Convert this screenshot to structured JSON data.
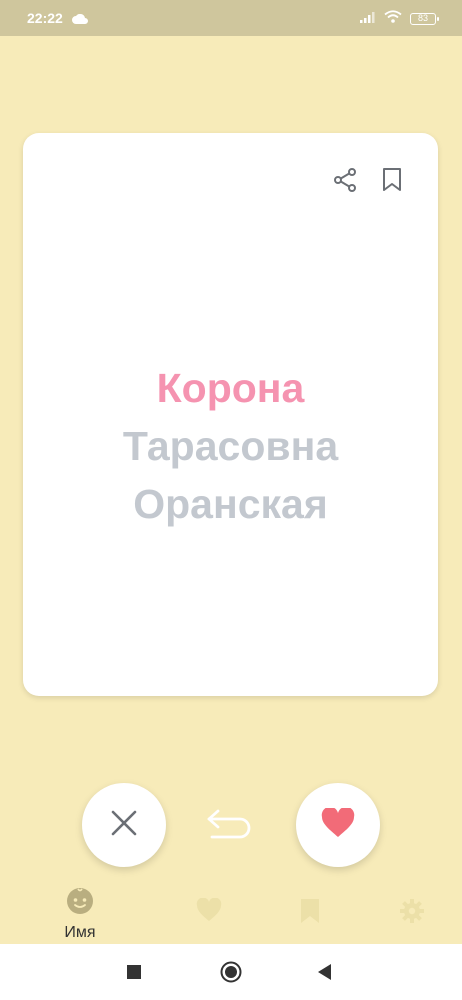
{
  "status_bar": {
    "time": "22:22",
    "battery": "83",
    "cloud_icon": "cloud-icon",
    "signal_icon": "signal-icon",
    "wifi_icon": "wifi-icon"
  },
  "card": {
    "first_name": "Корона",
    "patronymic": "Тарасовна",
    "surname": "Оранская",
    "share_icon": "share-icon",
    "bookmark_icon": "bookmark-icon"
  },
  "actions": {
    "dislike_icon": "close-icon",
    "undo_icon": "undo-icon",
    "like_icon": "heart-icon"
  },
  "bottom_nav": {
    "items": [
      {
        "icon": "baby-face-icon",
        "label": "Имя",
        "active": true
      },
      {
        "icon": "heart-icon",
        "label": "",
        "active": false
      },
      {
        "icon": "bookmark-icon",
        "label": "",
        "active": false
      },
      {
        "icon": "gear-icon",
        "label": "",
        "active": false
      }
    ]
  },
  "colors": {
    "background": "#f7ebb9",
    "status_bar": "#cfc69d",
    "first_name": "#f593b0",
    "secondary_name": "#c3c8cf",
    "like": "#f26b78"
  }
}
